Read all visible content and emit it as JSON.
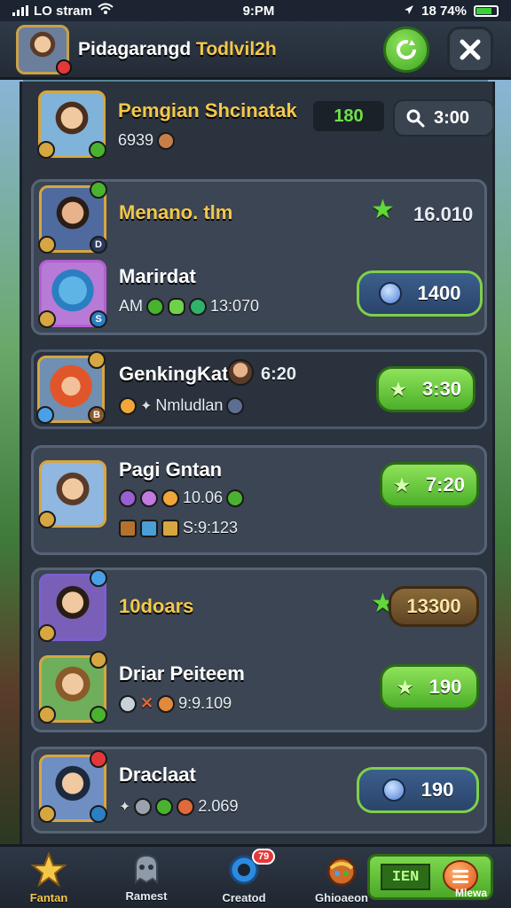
{
  "status_bar": {
    "carrier": "LO stram",
    "time": "9:PM",
    "battery": "18 74%"
  },
  "header": {
    "title_part1": "Pidagarangd",
    "title_part2": "Todlvil2h"
  },
  "top_row": {
    "name": "Pemgian Shcinatak",
    "sub_value": "6939",
    "score": "180",
    "search_value": "3:00"
  },
  "card1": {
    "row1": {
      "name": "Menano. tlm",
      "value": "16.010",
      "badge": "D"
    },
    "row2": {
      "name": "Marirdat",
      "sub_prefix": "AM",
      "sub_value": "13:070",
      "pill_value": "1400",
      "badge": "S"
    }
  },
  "card2": {
    "name": "GenkingKat",
    "time": "6:20",
    "sub_text": "Nmludlan",
    "pill_value": "3:30",
    "badge": "B"
  },
  "card3": {
    "name": "Pagi Gntan",
    "sub_line1": "10.06",
    "sub_line2": "S:9:123",
    "pill_value": "7:20"
  },
  "card4": {
    "row1": {
      "name": "10doars",
      "pill_value": "13300"
    },
    "row2": {
      "name": "Driar Peiteem",
      "sub_value": "9:9.109",
      "pill_value": "190"
    }
  },
  "card5": {
    "name": "Draclaat",
    "sub_value": "2.069",
    "pill_value": "190"
  },
  "bottom_nav": {
    "items": [
      "Fantan",
      "Ramest",
      "Creatod",
      "Ghioaeon"
    ],
    "notify_count": "79",
    "special_code": "IEN",
    "special_label": "Mlewa"
  }
}
